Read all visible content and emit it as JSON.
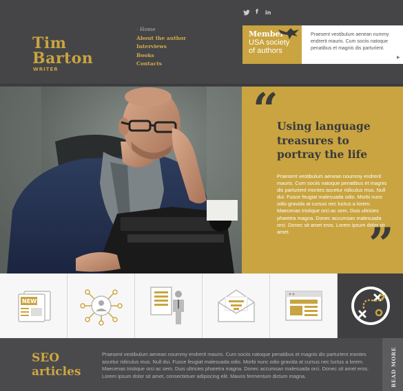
{
  "logo": {
    "first": "Tim",
    "last": "Barton",
    "sub": "WRITER"
  },
  "nav": [
    {
      "label": "Home"
    },
    {
      "label": "About the author"
    },
    {
      "label": "Interviews"
    },
    {
      "label": "Books"
    },
    {
      "label": "Contacts"
    }
  ],
  "social": {
    "twitter": "twitter-icon",
    "facebook_label": "f",
    "linkedin_label": "in"
  },
  "member": {
    "title": "Member",
    "sub1": "USA society",
    "sub2": "of authors",
    "text": "Praesent vestibulum aenean nummy endrerit mauris. Cum sociis natoque penatibus et magnis dis parturient."
  },
  "quote": {
    "open": "“",
    "close": "”",
    "title": "Using language treasures to portray the life",
    "body": "Praesent vestibulum aenean noummy endrerit mauris. Cum sociis natoque penatibus et magnis dis parturient montes ascetur ridiculus mus. Null dui. Fusce feugiat malesuada odio. Morbi nunc odio gravida at cursus nec luctus a lorem. Maecenas tristique orci ac sem. Duis ultricies pharetra magna. Donec accumsan malesuada orci. Donec sit amet eros. Lorem ipsum dolor sit amet."
  },
  "icons": [
    {
      "name": "news-icon",
      "label": "NEWS"
    },
    {
      "name": "network-icon"
    },
    {
      "name": "document-person-icon"
    },
    {
      "name": "envelope-icon"
    },
    {
      "name": "browser-window-icon"
    },
    {
      "name": "strategy-icon"
    }
  ],
  "seo": {
    "title_line1": "SEO",
    "title_line2": "articles",
    "text": "Praesent vestibulum aenean noummy endrerit mauris. Cum sociis natoque penatibus et magnis dis parturient montes ascetur ridiculus mus. Null dui. Fusce feugiat malesuada odio. Morbi nunc odio gravida at cursus nec luctus a lorem. Maecenas tristique orci ac sem. Duis ultricies pharetra magna. Donec accumsan malesuada orci. Donec sit amet eros. Lorem ipsum dolor sit amet, consectetuer adipiscing elit. Mauris fermentum dictum magna."
  },
  "read_more": "READ MORE",
  "colors": {
    "accent": "#c9a440",
    "dark": "#3f3f41",
    "light": "#f3f3f3"
  }
}
